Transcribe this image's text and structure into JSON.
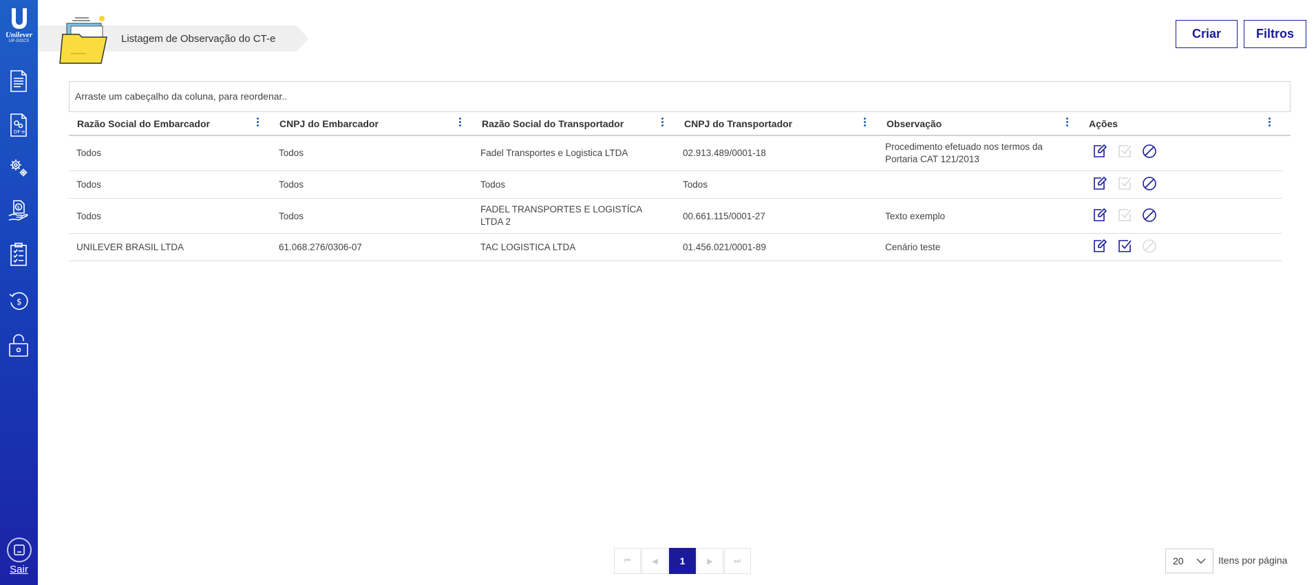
{
  "brand": {
    "name": "Unilever",
    "sub": "UP-DOCS"
  },
  "sidebar": {
    "items": [
      {
        "icon": "document-icon"
      },
      {
        "icon": "dfe-document-icon"
      },
      {
        "icon": "gears-icon"
      },
      {
        "icon": "hand-money-icon"
      },
      {
        "icon": "checklist-icon"
      },
      {
        "icon": "refund-icon"
      },
      {
        "icon": "lock-icon"
      }
    ],
    "logout_label": "Sair"
  },
  "header": {
    "title": "Listagem de Observação do CT-e",
    "create_label": "Criar",
    "filters_label": "Filtros"
  },
  "grid": {
    "group_hint": "Arraste um cabeçalho da coluna, para reordenar..",
    "columns": [
      "Razão Social do Embarcador",
      "CNPJ do Embarcador",
      "Razão Social do Transportador",
      "CNPJ do Transportador",
      "Observação",
      "Ações"
    ],
    "rows": [
      {
        "razao_emb": "Todos",
        "cnpj_emb": "Todos",
        "razao_transp": "Fadel Transportes e Logistica LTDA",
        "cnpj_transp": "02.913.489/0001-18",
        "observacao": "Procedimento efetuado nos termos da Portaria CAT 121/2013",
        "activate_enabled": false,
        "cancel_enabled": true
      },
      {
        "razao_emb": "Todos",
        "cnpj_emb": "Todos",
        "razao_transp": "Todos",
        "cnpj_transp": "Todos",
        "observacao": "",
        "activate_enabled": false,
        "cancel_enabled": true
      },
      {
        "razao_emb": "Todos",
        "cnpj_emb": "Todos",
        "razao_transp": "FADEL TRANSPORTES E LOGISTÍCA LTDA 2",
        "cnpj_transp": "00.661.115/0001-27",
        "observacao": "Texto exemplo",
        "activate_enabled": false,
        "cancel_enabled": true
      },
      {
        "razao_emb": "UNILEVER BRASIL LTDA",
        "cnpj_emb": "61.068.276/0306-07",
        "razao_transp": "TAC LOGISTICA LTDA",
        "cnpj_transp": "01.456.021/0001-89",
        "observacao": "Cenário teste",
        "activate_enabled": true,
        "cancel_enabled": false
      }
    ]
  },
  "pagination": {
    "first": "⏮",
    "prev": "◀",
    "current_page": "1",
    "next": "▶",
    "last": "⏭",
    "page_size": "20",
    "page_size_label": "Itens por página"
  },
  "colors": {
    "primary": "#1a1a9b",
    "sidebar_top": "#1f5fc9",
    "sidebar_bottom": "#1b23a5",
    "disabled_icon": "#d8d8d8"
  }
}
